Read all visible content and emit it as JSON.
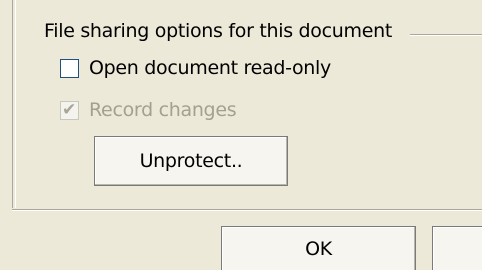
{
  "section": {
    "title": "File sharing options for this document"
  },
  "options": {
    "read_only": {
      "label": "Open document read-only",
      "checked": false,
      "enabled": true
    },
    "record_changes": {
      "label": "Record changes",
      "checked": true,
      "enabled": false
    }
  },
  "buttons": {
    "unprotect_label": "Unprotect..",
    "ok_label": "OK"
  },
  "colors": {
    "dialog_background": "#ece9d8",
    "disabled_text": "#a3a090",
    "checkbox_border": "#1c5180"
  },
  "icons": {
    "check": "checkmark-icon"
  }
}
